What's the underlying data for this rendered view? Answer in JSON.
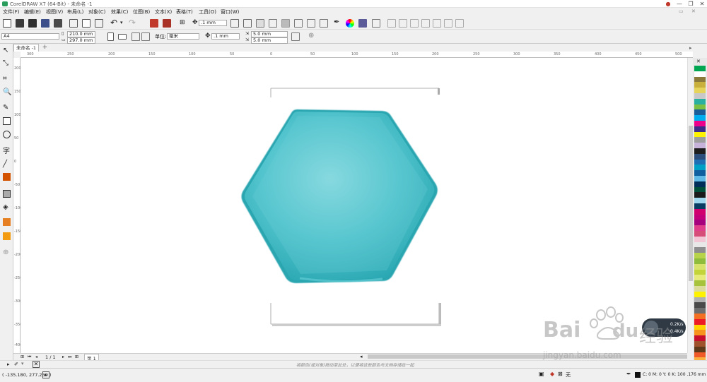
{
  "window": {
    "title": "CorelDRAW X7 (64-Bit) - 未命名 -1",
    "minimize": "—",
    "restore": "❐",
    "close": "✕"
  },
  "menu": [
    "文件(F)",
    "编辑(E)",
    "视图(V)",
    "布局(L)",
    "对象(C)",
    "效果(C)",
    "位图(B)",
    "文本(X)",
    "表格(T)",
    "工具(O)",
    "窗口(W)"
  ],
  "toolbar": {
    "nudge": ".1 mm"
  },
  "propertybar": {
    "page_size": "A4",
    "width": "210.0 mm",
    "height": "297.0 mm",
    "units_label": "单位:",
    "units": "毫米",
    "nudge": ".1 mm",
    "dup_x": "5.0 mm",
    "dup_y": "5.0 mm"
  },
  "tabs": {
    "document": "未命名 -1",
    "add": "+"
  },
  "ruler": {
    "h_labels": [
      "300",
      "250",
      "200",
      "150",
      "100",
      "50",
      "0",
      "50",
      "100",
      "150",
      "200",
      "250",
      "300",
      "350",
      "400",
      "450",
      "500"
    ],
    "v_labels": [
      "200",
      "150",
      "100",
      "50",
      "0",
      "-50",
      "-100",
      "-150",
      "-200",
      "-250",
      "-300",
      "-350",
      "-400"
    ]
  },
  "pagenav": {
    "counter": "1 / 1",
    "page_tab": "页 1"
  },
  "hint": "将颜色(或对象)拖动至此处，以便将这些颜色与文档存储在一起",
  "status": {
    "cursor": "( -135.180, 277.259 )",
    "fill": "无",
    "outline": "C: 0 M: 0 Y: 0 K: 100  .176 mm"
  },
  "speed": {
    "up": "0.2K/s",
    "down": "0.4K/s"
  },
  "watermark": {
    "brand": "Bai",
    "brand2": "du",
    "cn": "经验",
    "url": "jingyan.baidu.com"
  },
  "colors": {
    "accent": "#2a9d5c",
    "cushion": "#3fbec9",
    "cushion_light": "#7fd6dd",
    "cushion_dark": "#2aa6b1"
  },
  "palette": [
    "#00a651",
    "#ffffff",
    "#8c7a3a",
    "#c9b03c",
    "#e6d35a",
    "#c8c8c8",
    "#2ab0a0",
    "#7bc043",
    "#1a5e9a",
    "#00aeef",
    "#ec008c",
    "#3d2b8a",
    "#fff200",
    "#9e9e9e",
    "#c7b3d9",
    "#1e1e1e",
    "#2b4f7a",
    "#1f6fb5",
    "#00a0c6",
    "#0f5fa0",
    "#5fb7e6",
    "#002e5a",
    "#004f3b",
    "#1b1b1b",
    "#9fd8ee",
    "#0a3d62",
    "#d1006f",
    "#c3007a",
    "#a7007f",
    "#e03d8a",
    "#d64d7a",
    "#f3c6d6",
    "#e8e8e8",
    "#8e8e8e",
    "#b7d34a",
    "#8fbc3a",
    "#d7e26a",
    "#c3d43b",
    "#e5ea7a",
    "#a6c33b",
    "#dcdc9a",
    "#fff200",
    "#b0b0b0",
    "#4a4a4a",
    "#6d6d6d",
    "#f36f21",
    "#ed1c24",
    "#ffd200",
    "#f7941d",
    "#c8102e",
    "#a0522d",
    "#5e3a1a",
    "#f05a28",
    "#fbb040",
    "#00a651"
  ]
}
